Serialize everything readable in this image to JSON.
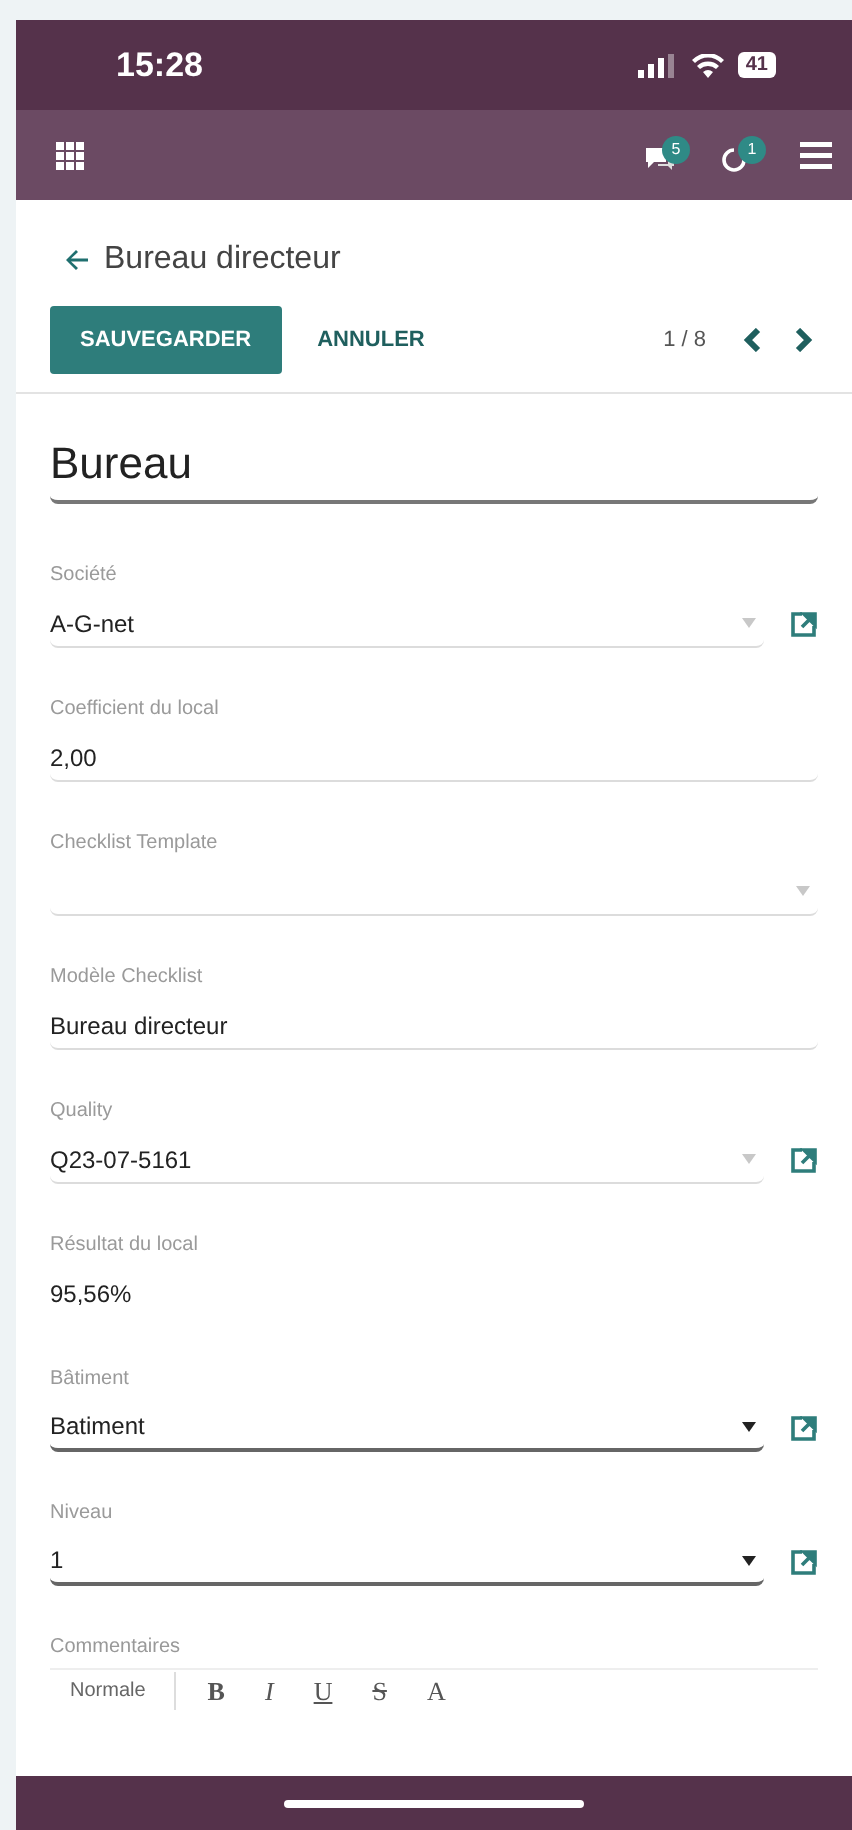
{
  "status_bar": {
    "time": "15:28",
    "battery": "41"
  },
  "app_bar": {
    "badges": [
      {
        "kind": "chat",
        "count": "5"
      },
      {
        "kind": "activity",
        "count": "1"
      }
    ]
  },
  "breadcrumb": {
    "title": "Bureau directeur"
  },
  "toolbar": {
    "save": "SAUVEGARDER",
    "discard": "ANNULER",
    "pager": "1 / 8"
  },
  "record": {
    "name": "Bureau"
  },
  "fields": [
    {
      "label": "Société",
      "value": "A-G-net",
      "kind": "many2one",
      "required": false
    },
    {
      "label": "Coefficient du local",
      "value": "2,00",
      "kind": "text",
      "required": false
    },
    {
      "label": "Checklist Template",
      "kind": "select",
      "required": false
    },
    {
      "label": "Modèle Checklist",
      "value": "Bureau directeur",
      "kind": "text",
      "required": false
    },
    {
      "label": "Quality",
      "value": "Q23-07-5161",
      "kind": "many2one",
      "required": false
    },
    {
      "label": "Résultat du local",
      "value": "95,56%",
      "kind": "readonly"
    },
    {
      "label": "Bâtiment",
      "value": "Batiment",
      "kind": "many2one",
      "required": true
    },
    {
      "label": "Niveau",
      "value": "1",
      "kind": "many2one",
      "required": true
    }
  ],
  "comments": {
    "label": "Commentaires",
    "style": "Normale",
    "tools": [
      "B",
      "I",
      "U",
      "S",
      "A"
    ]
  }
}
